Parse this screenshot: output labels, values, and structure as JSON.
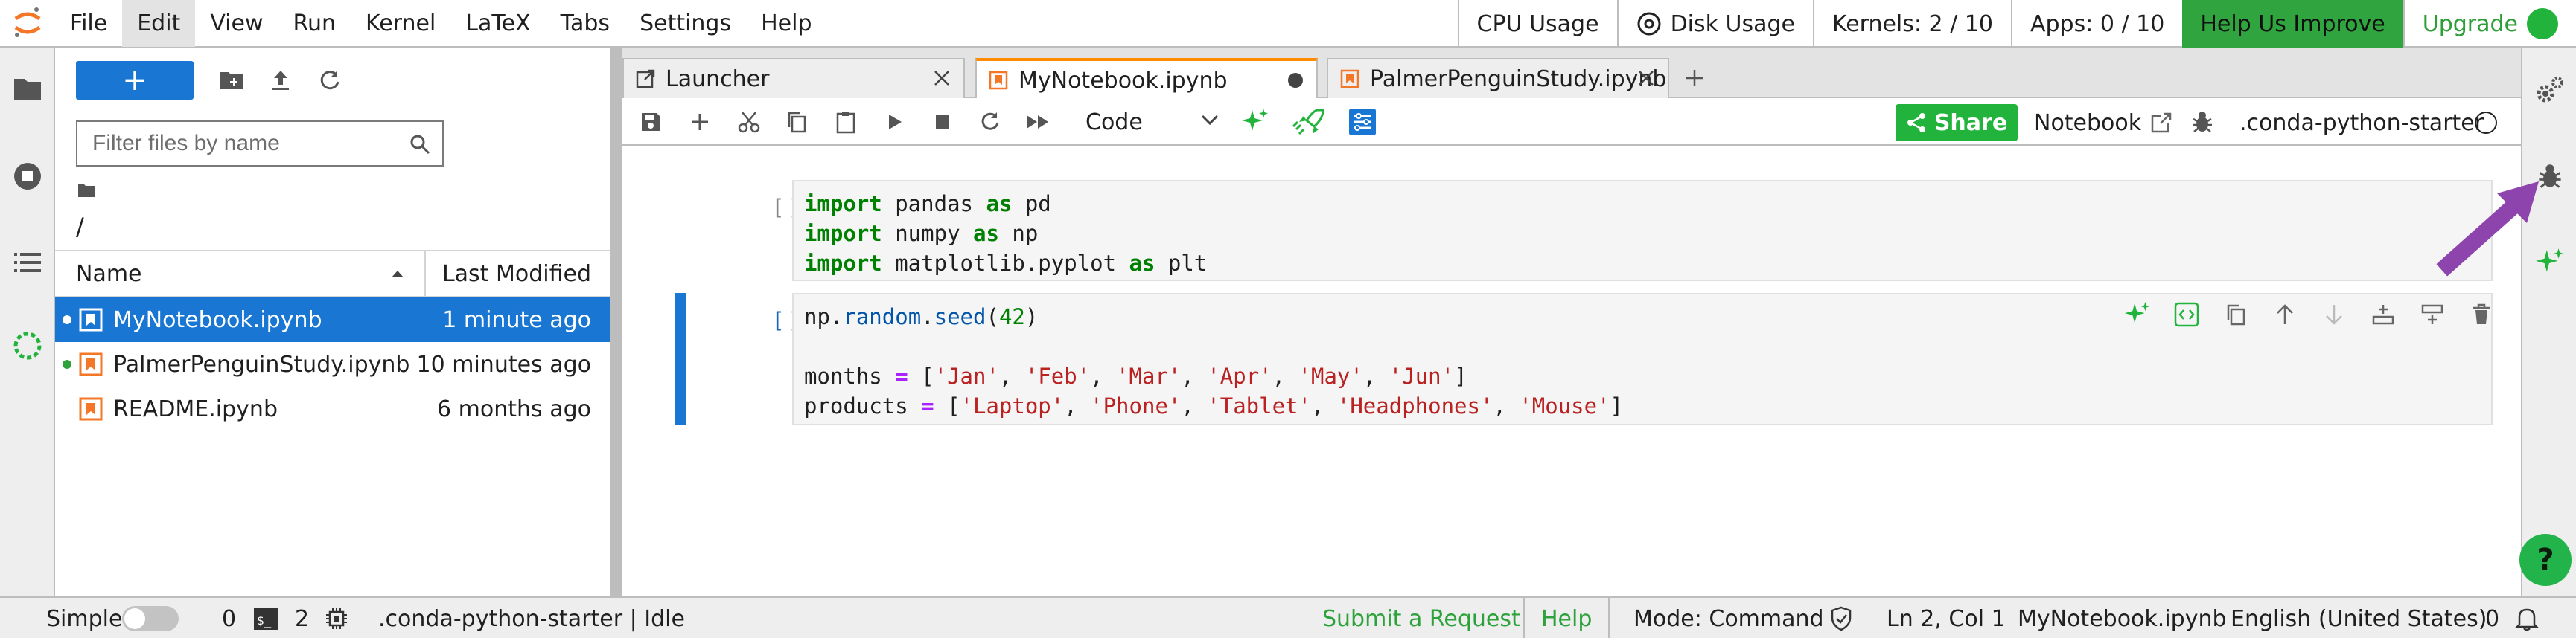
{
  "menubar": {
    "items": [
      "File",
      "Edit",
      "View",
      "Run",
      "Kernel",
      "LaTeX",
      "Tabs",
      "Settings",
      "Help"
    ],
    "active_item": "Edit",
    "cpu_usage": "CPU Usage",
    "disk_usage": "Disk Usage",
    "kernels": "Kernels: 2 / 10",
    "apps": "Apps: 0 / 10",
    "help_us_improve": "Help Us Improve",
    "upgrade": "Upgrade"
  },
  "filebrowser": {
    "new_button": "+",
    "filter_placeholder": "Filter files by name",
    "path": "/",
    "col_name": "Name",
    "col_modified": "Last Modified",
    "files": [
      {
        "name": "MyNotebook.ipynb",
        "modified": "1 minute ago",
        "selected": true,
        "running": true
      },
      {
        "name": "PalmerPenguinStudy.ipynb",
        "modified": "10 minutes ago",
        "selected": false,
        "running": true
      },
      {
        "name": "README.ipynb",
        "modified": "6 months ago",
        "selected": false,
        "running": false
      }
    ]
  },
  "tabs": [
    {
      "label": "Launcher"
    },
    {
      "label": "MyNotebook.ipynb"
    },
    {
      "label": "PalmerPenguinStudy.ipynb"
    }
  ],
  "toolbar": {
    "cell_type": "Code",
    "share": "Share",
    "notebook": "Notebook",
    "kernel": ".conda-python-starter"
  },
  "cells": [
    {
      "prompt": "[ ]:"
    },
    {
      "prompt": "[ ]:"
    }
  ],
  "statusbar": {
    "mode_label": "Simple",
    "count_a": "0",
    "count_b": "2",
    "kernel_status": ".conda-python-starter | Idle",
    "submit_request": "Submit a Request",
    "help": "Help",
    "mode": "Mode: Command",
    "position": "Ln 2, Col 1",
    "file": "MyNotebook.ipynb",
    "language": "English (United States)",
    "notifications": "0"
  },
  "colors": {
    "accent_blue": "#1976d2",
    "brand_green": "#21b33b",
    "tab_orange": "#ff8c00",
    "arrow_purple": "#8e44ad"
  }
}
